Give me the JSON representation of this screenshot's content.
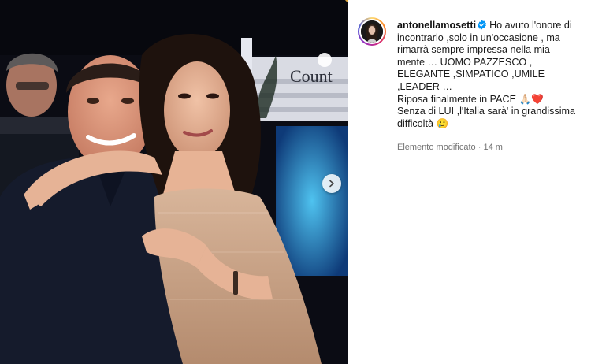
{
  "post": {
    "username": "antonellamosetti",
    "verified_icon": "verified-badge-icon",
    "caption_lines": [
      "Ho avuto l'onore di incontrarlo ,solo in un'occasione , ma rimarrà sempre impressa nella mia mente … UOMO PAZZESCO , ELEGANTE ,SIMPATICO ,UMILE ,LEADER …",
      "Riposa finalmente in PACE 🙏🏻❤️",
      "Senza di LUI ,l'Italia sarà' in grandissima difficoltà 🥲"
    ],
    "edited_label": "Elemento modificato",
    "separator": "·",
    "time_ago": "14 m"
  },
  "photo": {
    "sign_text": "Count",
    "next_icon": "chevron-right-icon"
  },
  "colors": {
    "verified": "#0095f6",
    "meta": "#737373",
    "photo_bg": "#0b0c14",
    "dress": "#c9a487"
  }
}
